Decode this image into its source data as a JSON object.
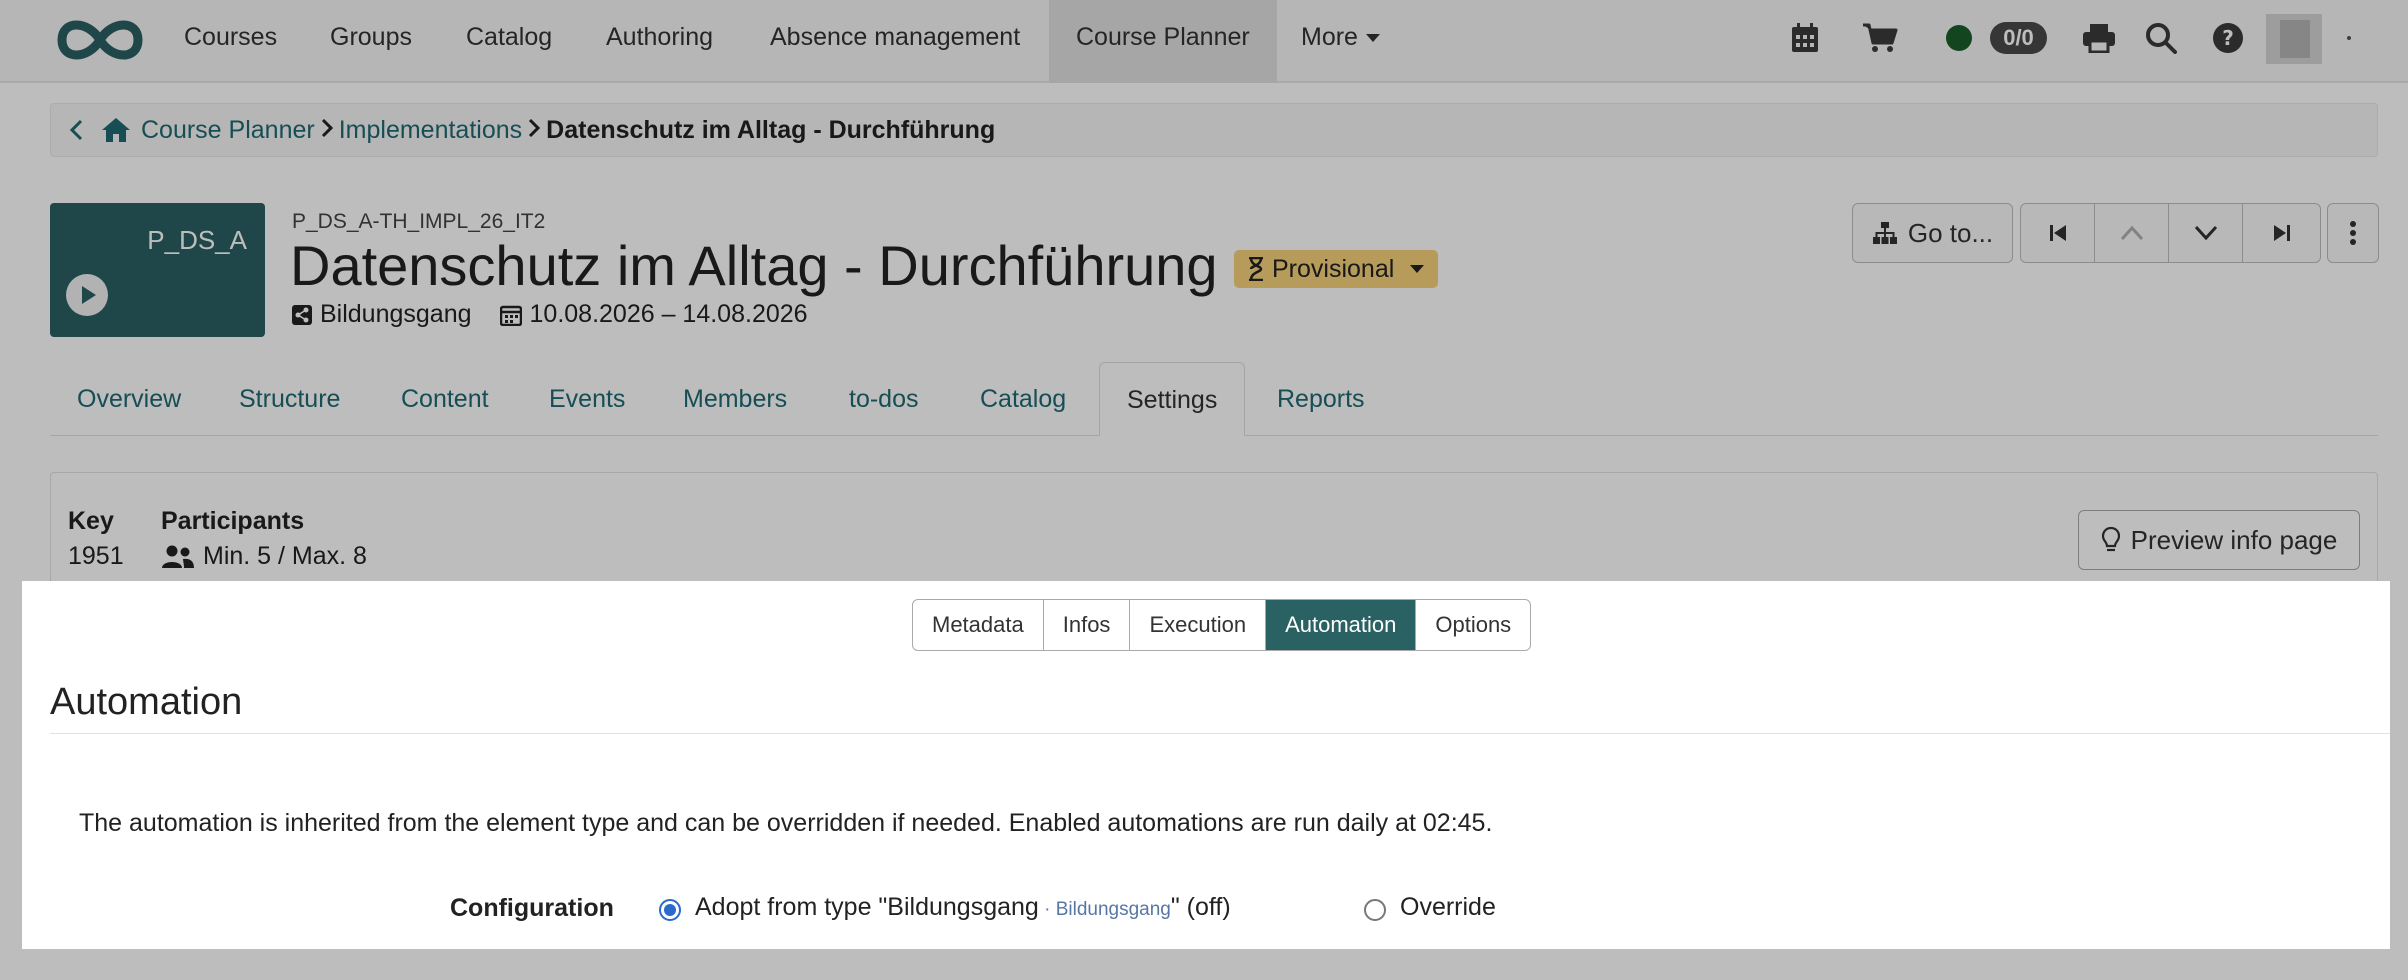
{
  "nav": {
    "items": [
      "Courses",
      "Groups",
      "Catalog",
      "Authoring",
      "Absence management",
      "Course Planner"
    ],
    "more_label": "More",
    "active": "Course Planner",
    "badge_count": "0/0"
  },
  "breadcrumb": {
    "items": [
      "Course Planner",
      "Implementations"
    ],
    "current": "Datenschutz im Alltag - Durchführung"
  },
  "header": {
    "thumb_label": "P_DS_A",
    "code": "P_DS_A-TH_IMPL_26_IT2",
    "title": "Datenschutz im Alltag - Durchführung",
    "status": "Provisional",
    "type": "Bildungsgang",
    "dates": "10.08.2026 – 14.08.2026",
    "goto_label": "Go to..."
  },
  "tabs": [
    "Overview",
    "Structure",
    "Content",
    "Events",
    "Members",
    "to-dos",
    "Catalog",
    "Settings",
    "Reports"
  ],
  "active_tab": "Settings",
  "info": {
    "key_label": "Key",
    "key_value": "1951",
    "participants_label": "Participants",
    "participants_value": "Min. 5 / Max. 8",
    "preview_label": "Preview info page"
  },
  "modal": {
    "segments": [
      "Metadata",
      "Infos",
      "Execution",
      "Automation",
      "Options"
    ],
    "active_segment": "Automation",
    "title": "Automation",
    "description": "The automation is inherited from the element type and can be overridden if needed. Enabled automations are run daily at 02:45.",
    "config_label": "Configuration",
    "option_adopt_prefix": "Adopt from type \"Bildungsgang",
    "option_adopt_sub": " · Bildungsgang",
    "option_adopt_suffix": "\" (off)",
    "option_override": "Override"
  },
  "colors": {
    "accent": "#2a6163",
    "link": "#1f6a73",
    "status_badge": "#f6d27a",
    "radio_selected": "#2a6acb"
  }
}
